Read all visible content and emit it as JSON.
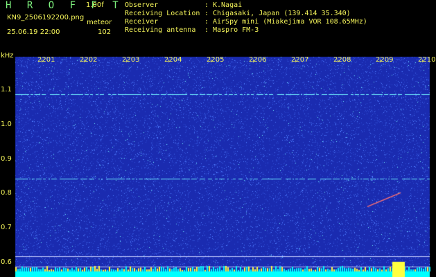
{
  "header": {
    "app_title": "H R O F F T",
    "version": "1.00f",
    "filename": "KN9_2506192200.png",
    "mode": "meteor",
    "datetime": "25.06.19 22:00",
    "count": "102",
    "info": [
      {
        "key": "Observer",
        "value": "K.Nagai"
      },
      {
        "key": "Receiving Location",
        "value": "Chigasaki, Japan (139.414 35.340)"
      },
      {
        "key": "Receiver",
        "value": "AirSpy mini (Miakejima VOR 108.65MHz)"
      },
      {
        "key": "Receiving antenna",
        "value": "Maspro FM-3"
      }
    ]
  },
  "chart_data": {
    "type": "heatmap",
    "y_unit": "kHz",
    "y_ticks": [
      "1.1",
      "1.0",
      "0.9",
      "0.8",
      "0.7",
      "0.6"
    ],
    "x_ticks": [
      "2201",
      "2202",
      "2203",
      "2204",
      "2205",
      "2206",
      "2207",
      "2208",
      "2209",
      "2210"
    ],
    "ylim": [
      0.58,
      1.2
    ],
    "colors": {
      "background": "#1a2bb0",
      "noise": "#4f7cff",
      "signal": "#6ff0ff",
      "baseline": "#00ffff",
      "yellow": "#ffff40"
    },
    "features": [
      {
        "type": "horizontal_line",
        "freq_khz": 1.09
      },
      {
        "type": "horizontal_line",
        "freq_khz": 0.845
      },
      {
        "type": "meteor_echo",
        "time": "2209.5",
        "freq_khz": 0.8
      }
    ]
  }
}
